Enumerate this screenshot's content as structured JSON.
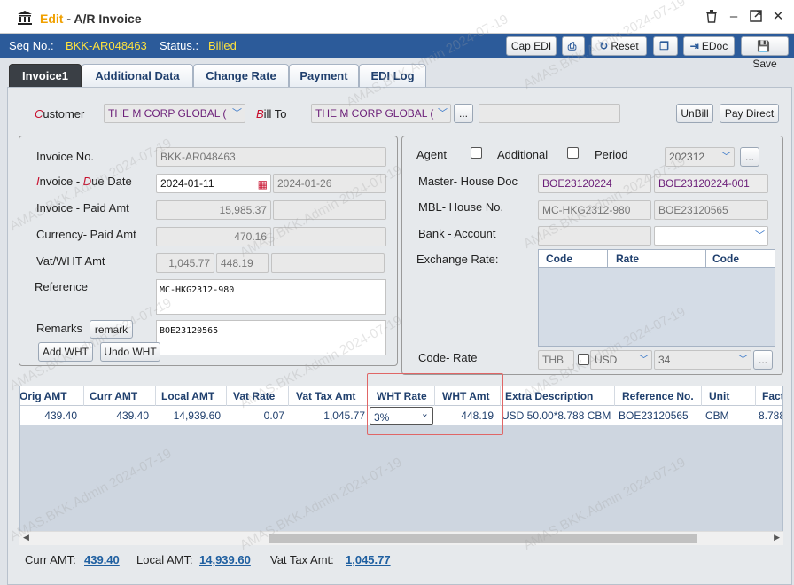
{
  "window": {
    "mode": "Edit",
    "title_sep": " - ",
    "title": "A/R Invoice"
  },
  "info": {
    "seq_label": "Seq No.:",
    "seq_value": "BKK-AR048463",
    "status_label": "Status.:",
    "status_value": "Billed"
  },
  "toolbar": {
    "cap_edi": "Cap EDI",
    "reset": "Reset",
    "edoc": "EDoc",
    "save": "Save"
  },
  "tabs": [
    "Invoice1",
    "Additional Data",
    "Change Rate",
    "Payment",
    "EDI Log"
  ],
  "customer": {
    "label_first": "C",
    "label_rest": "ustomer",
    "value": "THE M CORP GLOBAL (",
    "billto_first": "B",
    "billto_rest": "ill To",
    "billto_value": "THE M CORP GLOBAL (",
    "unbill": "UnBill",
    "pay_direct": "Pay Direct"
  },
  "left": {
    "invoice_no_label": "Invoice No.",
    "invoice_no": "BKK-AR048463",
    "inv_due_label_1": "I",
    "inv_due_label_2": "nvoice - ",
    "inv_due_label_3": "D",
    "inv_due_label_4": "ue Date",
    "invoice_date": "2024-01-11",
    "due_date": "2024-01-26",
    "inv_paid_label": "Invoice - Paid Amt",
    "invoice_amt": "15,985.37",
    "paid_amt": "",
    "cur_paid_label": "Currency- Paid Amt",
    "currency_amt": "470.16",
    "currency_paid": "",
    "vat_wht_label": "Vat/WHT Amt",
    "vat_amt": "1,045.77",
    "wht_amt": "448.19",
    "vat_wht_extra": "",
    "reference_label": "Reference",
    "reference": "MC-HKG2312-980",
    "remarks_label": "Remarks",
    "remark_btn": "remark",
    "remarks": "BOE23120565",
    "add_wht": "Add WHT",
    "undo_wht": "Undo WHT"
  },
  "right": {
    "agent_label": "Agent",
    "additional_label": "Additional",
    "period_label": "Period",
    "period": "202312",
    "master_house_label": "Master- House Doc",
    "master_doc": "BOE23120224",
    "house_doc": "BOE23120224-001",
    "mbl_house_label": "MBL- House No.",
    "mbl_no": "MC-HKG2312-980",
    "house_no": "BOE23120565",
    "bank_label": "Bank - Account",
    "exchange_label": "Exchange Rate:",
    "exchange_cols": [
      "Code",
      "Rate",
      "Code"
    ],
    "code_rate_label": "Code- Rate",
    "code": "THB",
    "currency": "USD",
    "rate": "34"
  },
  "grid": {
    "columns": [
      "Orig AMT",
      "Curr AMT",
      "Local AMT",
      "Vat Rate",
      "Vat Tax Amt",
      "WHT Rate",
      "WHT Amt",
      "Extra Description",
      "Reference No.",
      "Unit",
      "Fact"
    ],
    "row": {
      "orig_amt": "439.40",
      "curr_amt": "439.40",
      "local_amt": "14,939.60",
      "vat_rate": "0.07",
      "vat_tax_amt": "1,045.77",
      "wht_rate": "3%",
      "wht_amt": "448.19",
      "extra_description": "USD 50.00*8.788 CBM",
      "reference_no": "BOE23120565",
      "unit": "CBM",
      "fact": "8.788"
    }
  },
  "totals": {
    "curr_label": "Curr AMT:",
    "curr_value": "439.40",
    "local_label": "Local AMT:",
    "local_value": "14,939.60",
    "vat_label": "Vat Tax Amt:",
    "vat_value": "1,045.77"
  },
  "watermark": "AMAS.BKK.Admin 2024-07-19",
  "colors": {
    "info_bar": "#2c5b9a",
    "status_value": "#ffe23d",
    "link_total": "#1f5fa0",
    "highlight": "#e06666"
  }
}
